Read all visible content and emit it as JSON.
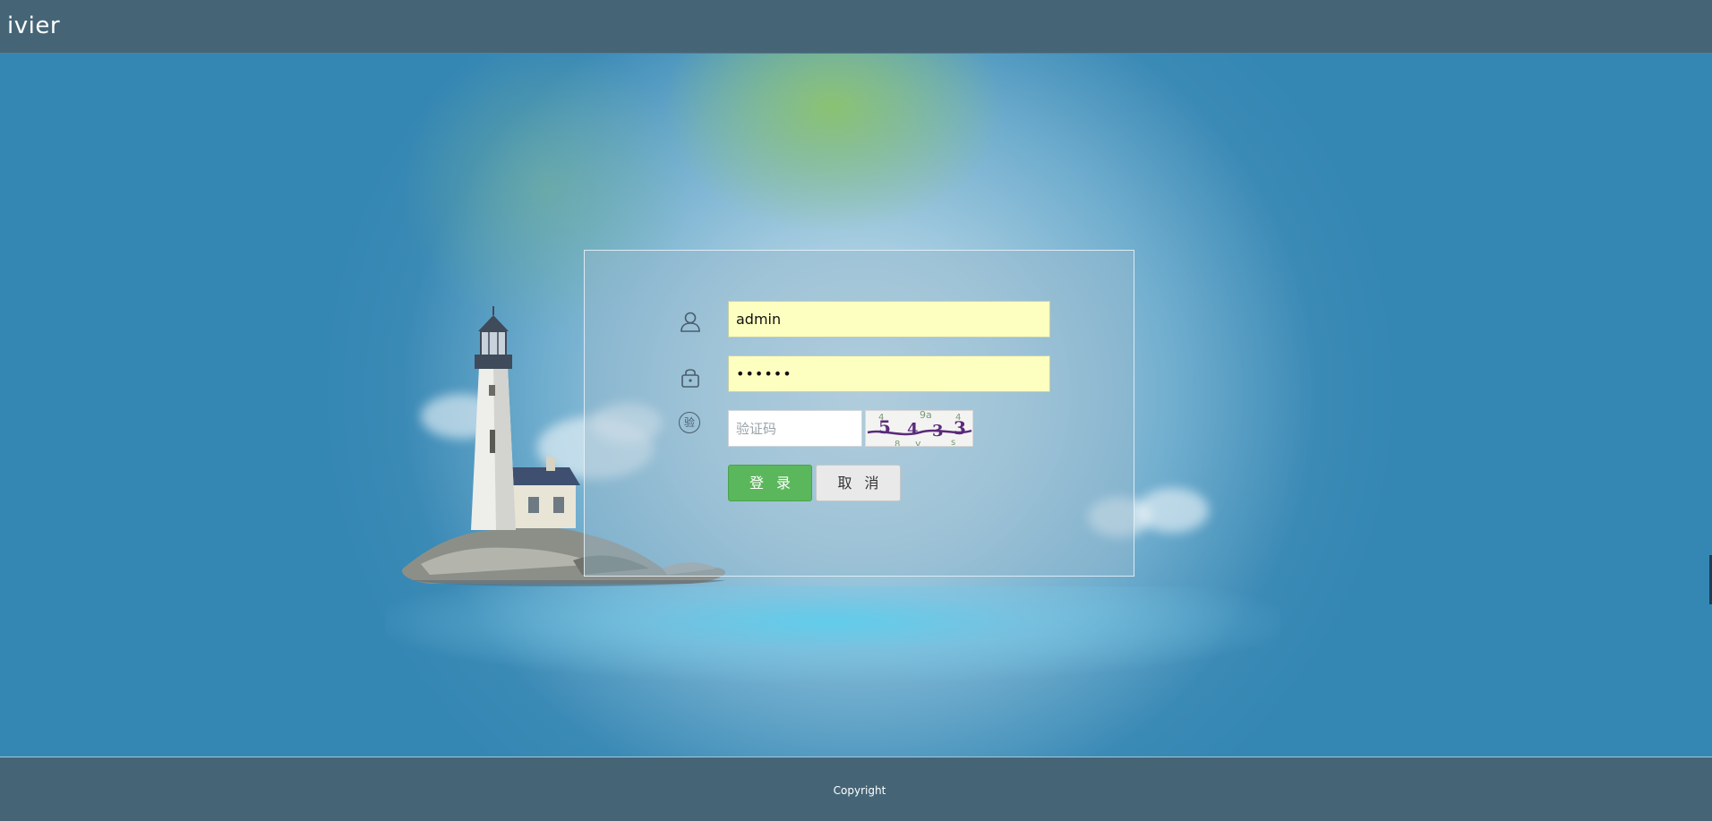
{
  "header": {
    "brand": "ivier"
  },
  "login": {
    "username_value": "admin",
    "password_value": "••••••",
    "captcha_placeholder": "验证码",
    "captcha_icon_glyph": "验",
    "captcha_chars": [
      "5",
      "4",
      "3",
      "3"
    ],
    "login_label": "登录",
    "cancel_label": "取消",
    "icons": {
      "username": "user-icon",
      "password": "lock-icon",
      "captcha": "captcha-icon"
    },
    "colors": {
      "login_button": "#5bb75b",
      "cancel_button": "#e9e9e9",
      "autofill_background": "#fdffc0"
    }
  },
  "footer": {
    "copyright": "Copyright"
  }
}
